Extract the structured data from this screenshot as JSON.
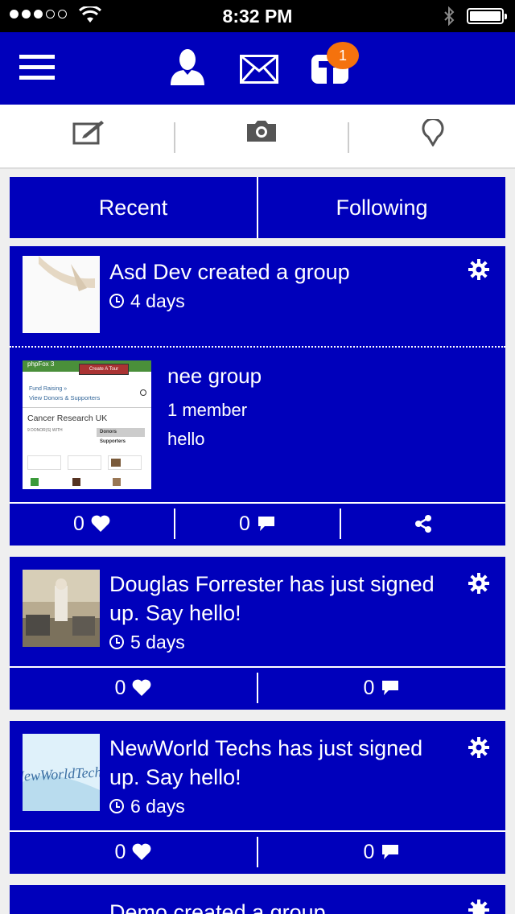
{
  "status_bar": {
    "time": "8:32 PM"
  },
  "navbar": {
    "notification_count": "1"
  },
  "tabs": [
    {
      "label": "Recent"
    },
    {
      "label": "Following"
    }
  ],
  "feed": [
    {
      "headline": "Asd Dev created a group",
      "time": "4 days",
      "attachment": {
        "name": "nee group",
        "members": "1 member",
        "description": "hello",
        "preview": {
          "app_name": "phpFox 3",
          "button": "Create A Tour",
          "breadcrumb": "Fund Raising »",
          "link": "View Donors & Supporters",
          "title": "Cancer Research UK",
          "caption": "9 DONOR(S) WITH",
          "tab_donors": "Donors",
          "tab_supporters": "Supporters"
        }
      },
      "likes": "0",
      "comments": "0"
    },
    {
      "headline": "Douglas Forrester has just signed up. Say hello!",
      "time": "5 days",
      "likes": "0",
      "comments": "0"
    },
    {
      "headline": "NewWorld Techs has just signed up. Say hello!",
      "time": "6 days",
      "thumb_text": "NewWorldTechs",
      "likes": "0",
      "comments": "0"
    },
    {
      "headline": "Demo created a group"
    }
  ],
  "colors": {
    "primary": "#0000bb",
    "badge": "#f5720d"
  }
}
